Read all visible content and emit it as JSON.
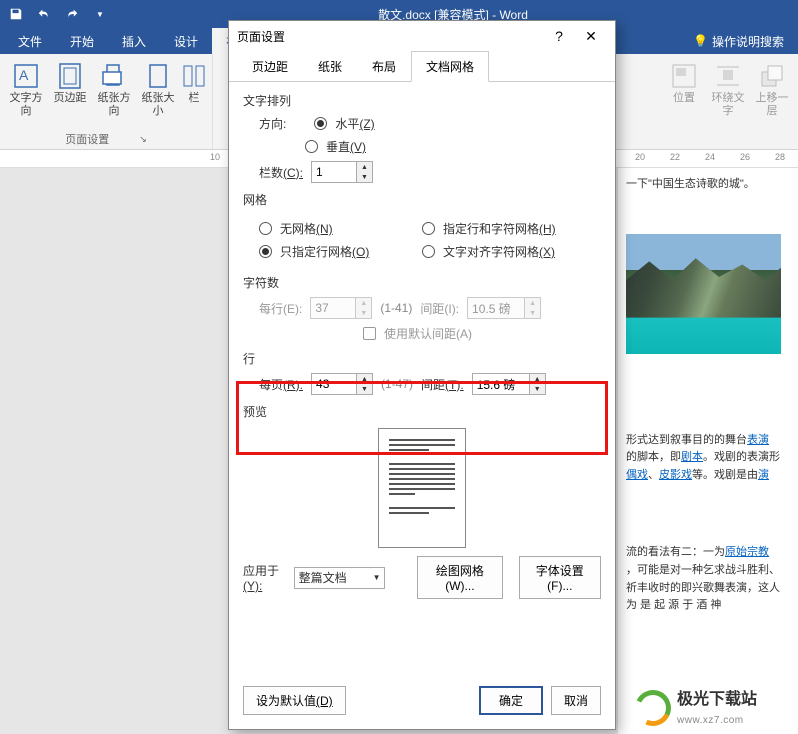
{
  "app": {
    "title": "散文.docx [兼容模式] - Word"
  },
  "ribbon_tabs": [
    "文件",
    "开始",
    "插入",
    "设计",
    "布",
    "操作说明搜索"
  ],
  "ribbon_group_pagesetup": "页面设置",
  "ribbon_btns": {
    "text_dir": "文字方向",
    "margin": "页边距",
    "orient": "纸张方向",
    "size": "纸张大小",
    "cols": "栏",
    "pos": "位置",
    "wrap": "环绕文字",
    "upone": "上移一层"
  },
  "ruler": [
    "10",
    "20",
    "22",
    "24",
    "26",
    "28"
  ],
  "doc": {
    "line_top": "一下\"中国生态诗歌的城\"。",
    "para1_a": "形式达到叙事目的的舞台",
    "para1_link1": "表演",
    "para1_b": "的脚本，即",
    "para1_link2": "剧本",
    "para1_c": "。戏剧的表演形",
    "para1_link3": "偶戏",
    "para1_d": "、",
    "para1_link4": "皮影戏",
    "para1_e": "等。戏剧是由",
    "para1_link5": "演",
    "para2_a": "流的看法有二：一为",
    "para2_link1": "原始宗教",
    "para2_b": "，可能是对一种乞求战斗胜利、祈丰收时的即兴歌舞表演，这人  为  是  起  源  于  酒  神",
    "logo_cn": "极光下载站",
    "logo_url": "www.xz7.com"
  },
  "dialog": {
    "title": "页面设置",
    "tabs": [
      "页边距",
      "纸张",
      "布局",
      "文档网格"
    ],
    "text_arrange": "文字排列",
    "direction": "方向:",
    "horiz": "水平",
    "horiz_k": "(Z)",
    "vert": "垂直",
    "vert_k": "(V)",
    "cols": "栏数",
    "cols_k": "(C):",
    "cols_val": "1",
    "grid": "网格",
    "nogrid": "无网格",
    "nogrid_k": "(N)",
    "linechar": "指定行和字符网格",
    "linechar_k": "(H)",
    "lineonly": "只指定行网格",
    "lineonly_k": "(O)",
    "charalign": "文字对齐字符网格",
    "charalign_k": "(X)",
    "chars": "字符数",
    "perline": "每行(E):",
    "perline_val": "37",
    "perline_rng": "(1-41)",
    "spacing1": "间距(I):",
    "spacing1_val": "10.5 磅",
    "default_sp": "使用默认间距(A)",
    "lines": "行",
    "perpage": "每页",
    "perpage_k": "(R):",
    "perpage_val": "43",
    "perpage_rng": "(1-47)",
    "spacing2": "间距",
    "spacing2_k": "(T):",
    "spacing2_val": "15.6 磅",
    "preview": "预览",
    "apply_to": "应用于",
    "apply_to_k": "(Y):",
    "apply_val": "整篇文档",
    "draw_grid": "绘图网格(W)...",
    "font_set": "字体设置(F)...",
    "set_default": "设为默认值",
    "set_default_k": "(D)",
    "ok": "确定",
    "cancel": "取消"
  }
}
